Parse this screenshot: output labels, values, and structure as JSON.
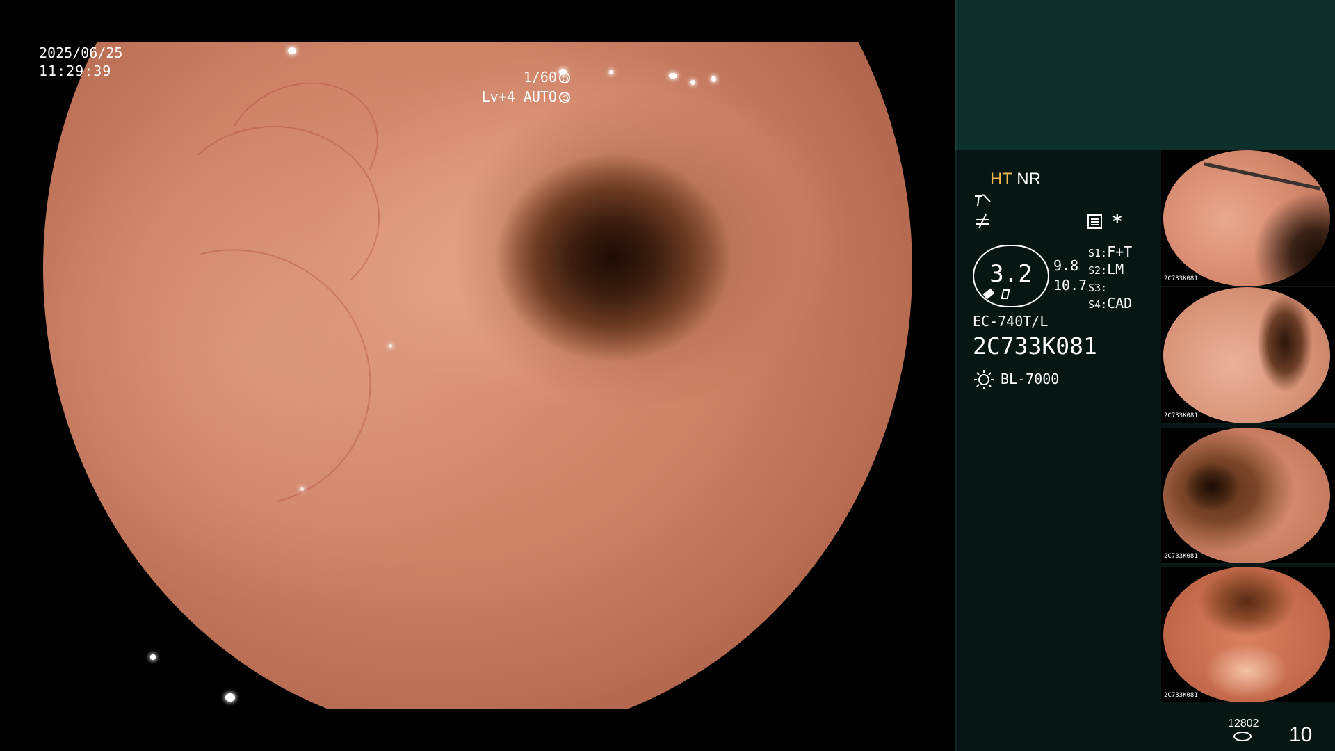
{
  "overlay": {
    "date": "2025/06/25",
    "time": "11:29:39",
    "shutter": "1/60",
    "level": "Lv+4",
    "iris": "AUTO"
  },
  "panel": {
    "mode_ht": "HT",
    "mode_nr": "NR",
    "zoom_value": "3.2",
    "zoom_line1": "9.8",
    "zoom_line2": "10.7",
    "asterisk": "*",
    "s1_label": "S1:",
    "s1_value": "F+T",
    "s2_label": "S2:",
    "s2_value": "LM",
    "s3_label": "S3:",
    "s3_value": "",
    "s4_label": "S4:",
    "s4_value": "CAD",
    "scope_model": "EC-740T/L",
    "serial": "2C733K081",
    "light_source": "BL-7000"
  },
  "thumbnails": [
    {
      "label": "2C733K081"
    },
    {
      "label": "2C733K081"
    },
    {
      "label": "2C733K081"
    },
    {
      "label": "2C733K081"
    }
  ],
  "footer": {
    "storage_count": "12802",
    "image_count": "10"
  },
  "icons": [
    "light-source-icon",
    "disk-icon",
    "iris-icon",
    "settings-list-icon",
    "curve-icon",
    "slash-icon",
    "pen-icon",
    "flag-icon"
  ]
}
